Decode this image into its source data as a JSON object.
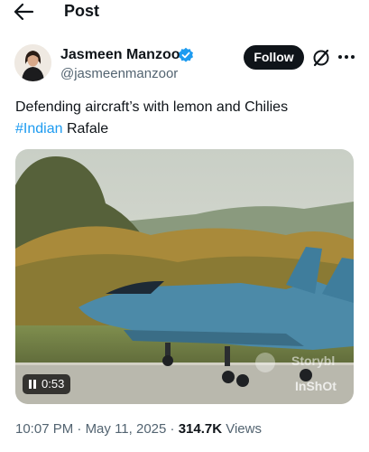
{
  "header": {
    "title": "Post",
    "back_icon": "arrow-left-icon"
  },
  "author": {
    "name": "Jasmeen Manzoor",
    "handle": "@jasmeenmanzoor",
    "verified": true,
    "verified_color": "#1d9bf0"
  },
  "actions": {
    "follow_label": "Follow",
    "grok_icon": "grok-icon",
    "more_icon": "more-horizontal-icon"
  },
  "tweet": {
    "text_line1": "Defending aircraft’s with lemon and Chilies",
    "hashtag": "#Indian",
    "text_after_hashtag": " Rafale"
  },
  "media": {
    "type": "video",
    "duration": "0:53",
    "state_icon": "pause-icon",
    "watermark_1": "Storybl",
    "watermark_2": "InShOt"
  },
  "meta": {
    "time": "10:07 PM",
    "separator": " · ",
    "date": "May 11, 2025",
    "views_count": "314.7K",
    "views_label": " Views"
  },
  "colors": {
    "link": "#1d9bf0",
    "text": "#0f1419",
    "secondary": "#536471",
    "button_bg": "#0f1419"
  }
}
